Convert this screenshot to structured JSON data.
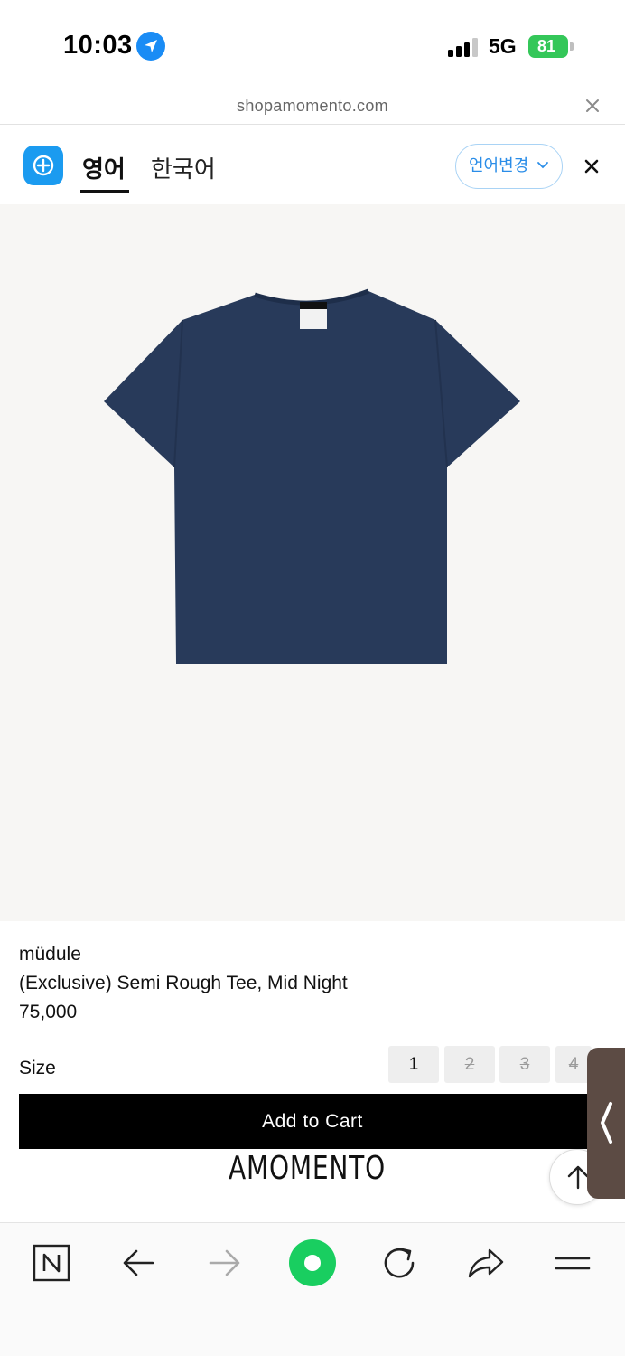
{
  "status_bar": {
    "time": "10:03",
    "network": "5G",
    "battery": "81"
  },
  "browser": {
    "url": "shopamomento.com"
  },
  "translate_bar": {
    "tabs": [
      "영어",
      "한국어"
    ],
    "active_tab": "영어",
    "change_language_label": "언어변경"
  },
  "product": {
    "brand": "müdule",
    "name": "(Exclusive) Semi Rough Tee, Mid Night",
    "price": "75,000",
    "color": "#283a5a",
    "size_label": "Size",
    "sizes": [
      {
        "label": "1",
        "available": true
      },
      {
        "label": "2",
        "available": false
      },
      {
        "label": "3",
        "available": false
      },
      {
        "label": "4",
        "available": false
      }
    ],
    "add_to_cart_label": "Add to Cart"
  },
  "footer": {
    "logo_text": "AMOMENTO"
  },
  "toolbar": {
    "items": [
      "naver-home-icon",
      "back-arrow-icon",
      "forward-arrow-icon",
      "green-home-dot",
      "refresh-icon",
      "share-icon",
      "menu-icon"
    ]
  },
  "colors": {
    "accent": "#1b9bf0",
    "battery": "#34c759",
    "home_dot": "#19ce60"
  }
}
